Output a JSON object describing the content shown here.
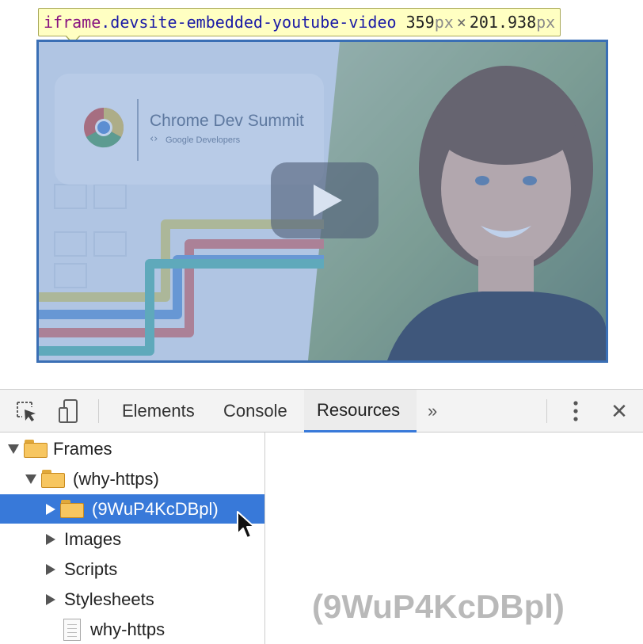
{
  "tooltip": {
    "tag": "iframe",
    "class_name": ".devsite-embedded-youtube-video",
    "width_value": "359",
    "width_unit": "px",
    "times": "×",
    "height_value": "201.938",
    "height_unit": "px"
  },
  "video": {
    "brand_title": "Chrome Dev Summit",
    "brand_subtitle": "Google Developers",
    "brand_sub_icon": "‹›",
    "play_icon": "youtube-play-icon"
  },
  "devtools": {
    "toolbar": {
      "inspect_icon": "inspect-element-icon",
      "device_icon": "device-mode-icon",
      "tabs": [
        {
          "label": "Elements",
          "active": false
        },
        {
          "label": "Console",
          "active": false
        },
        {
          "label": "Resources",
          "active": true
        }
      ],
      "overflow_label": "»",
      "menu_icon": "vertical-dots-icon",
      "close_label": "✕"
    },
    "tree": [
      {
        "label": "Frames",
        "expanded": true,
        "icon": "folder-icon"
      },
      {
        "label": "(why-https)",
        "expanded": true,
        "icon": "folder-icon"
      },
      {
        "label": "(9WuP4KcDBpl)",
        "expanded": false,
        "icon": "folder-icon",
        "selected": true
      },
      {
        "label": "Images",
        "expanded": false
      },
      {
        "label": "Scripts",
        "expanded": false
      },
      {
        "label": "Stylesheets",
        "expanded": false
      },
      {
        "label": "why-https",
        "icon": "document-icon"
      }
    ],
    "main_label": "(9WuP4KcDBpl)"
  },
  "colors": {
    "selection": "#3879d9",
    "tooltip_bg": "#ffffc2",
    "video_border": "#3a6fb5"
  }
}
